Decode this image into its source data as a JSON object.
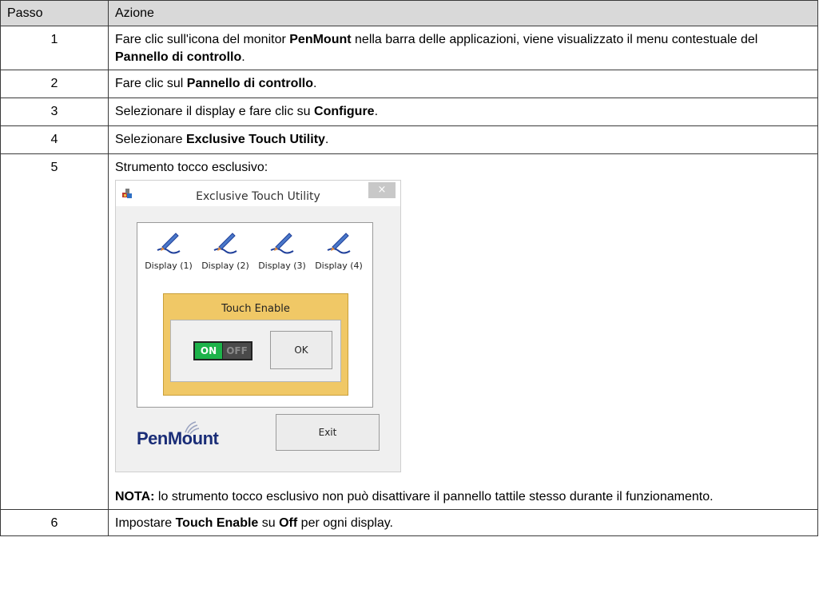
{
  "table": {
    "headers": [
      "Passo",
      "Azione"
    ],
    "rows": [
      {
        "step": "1",
        "parts": [
          {
            "t": "Fare clic sull'icona del monitor ",
            "b": false
          },
          {
            "t": "PenMount",
            "b": true
          },
          {
            "t": " nella barra delle applicazioni, viene visualizzato il menu contestuale del ",
            "b": false
          },
          {
            "t": "Pannello di controllo",
            "b": true
          },
          {
            "t": ".",
            "b": false
          }
        ]
      },
      {
        "step": "2",
        "parts": [
          {
            "t": "Fare clic sul ",
            "b": false
          },
          {
            "t": "Pannello di controllo",
            "b": true
          },
          {
            "t": ".",
            "b": false
          }
        ]
      },
      {
        "step": "3",
        "parts": [
          {
            "t": "Selezionare il display e fare clic su ",
            "b": false
          },
          {
            "t": "Configure",
            "b": true
          },
          {
            "t": ".",
            "b": false
          }
        ]
      },
      {
        "step": "4",
        "parts": [
          {
            "t": "Selezionare ",
            "b": false
          },
          {
            "t": "Exclusive Touch Utility",
            "b": true
          },
          {
            "t": ".",
            "b": false
          }
        ]
      },
      {
        "step": "5",
        "intro": "Strumento tocco esclusivo:",
        "note_label": "NOTA:",
        "note_text": " lo strumento tocco esclusivo non può disattivare il pannello tattile stesso durante il funzionamento."
      },
      {
        "step": "6",
        "parts": [
          {
            "t": "Impostare ",
            "b": false
          },
          {
            "t": "Touch Enable",
            "b": true
          },
          {
            "t": " su ",
            "b": false
          },
          {
            "t": "Off",
            "b": true
          },
          {
            "t": " per ogni display.",
            "b": false
          }
        ]
      }
    ]
  },
  "dialog": {
    "title": "Exclusive Touch Utility",
    "close_glyph": "×",
    "displays": [
      "Display (1)",
      "Display (2)",
      "Display (3)",
      "Display (4)"
    ],
    "touch_group_title": "Touch Enable",
    "toggle_on": "ON",
    "toggle_off": "OFF",
    "ok_label": "OK",
    "exit_label": "Exit",
    "logo_pen": "Pen",
    "logo_mount": "Mount",
    "colors": {
      "toggle_on": "#1db34a",
      "group_bg": "#f0c866",
      "logo": "#1a2d77"
    }
  }
}
